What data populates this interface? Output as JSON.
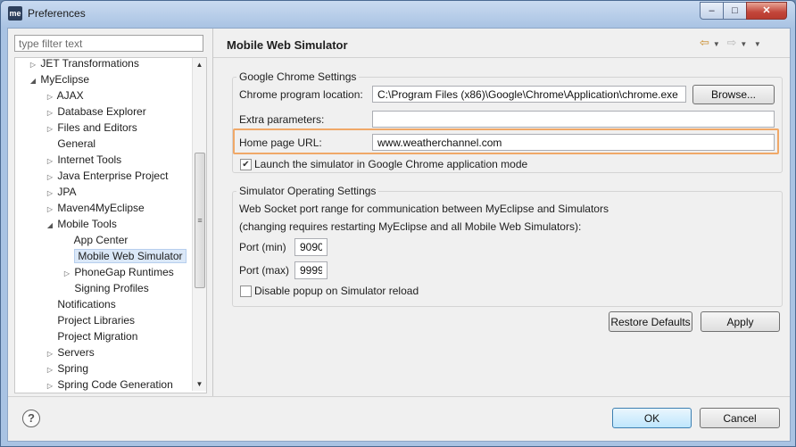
{
  "window": {
    "icon_text": "me",
    "title": "Preferences",
    "min": "–",
    "max": "□",
    "close": "✕"
  },
  "filter": {
    "placeholder": "type filter text"
  },
  "tree": {
    "items": [
      {
        "label": "JET Transformations",
        "arrow": "▷"
      },
      {
        "label": "MyEclipse",
        "arrow": "◢"
      },
      {
        "label": "AJAX",
        "arrow": "▷"
      },
      {
        "label": "Database Explorer",
        "arrow": "▷"
      },
      {
        "label": "Files and Editors",
        "arrow": "▷"
      },
      {
        "label": "General",
        "arrow": ""
      },
      {
        "label": "Internet Tools",
        "arrow": "▷"
      },
      {
        "label": "Java Enterprise Project",
        "arrow": "▷"
      },
      {
        "label": "JPA",
        "arrow": "▷"
      },
      {
        "label": "Maven4MyEclipse",
        "arrow": "▷"
      },
      {
        "label": "Mobile Tools",
        "arrow": "◢"
      },
      {
        "label": "App Center",
        "arrow": ""
      },
      {
        "label": "Mobile Web Simulator",
        "arrow": ""
      },
      {
        "label": "PhoneGap Runtimes",
        "arrow": "▷"
      },
      {
        "label": "Signing Profiles",
        "arrow": ""
      },
      {
        "label": "Notifications",
        "arrow": ""
      },
      {
        "label": "Project Libraries",
        "arrow": ""
      },
      {
        "label": "Project Migration",
        "arrow": ""
      },
      {
        "label": "Servers",
        "arrow": "▷"
      },
      {
        "label": "Spring",
        "arrow": "▷"
      },
      {
        "label": "Spring Code Generation",
        "arrow": "▷"
      }
    ],
    "selected": "Mobile Web Simulator"
  },
  "page": {
    "title": "Mobile Web Simulator"
  },
  "chrome": {
    "group_title": "Google Chrome Settings",
    "location_label": "Chrome program location:",
    "location_value": "C:\\Program Files (x86)\\Google\\Chrome\\Application\\chrome.exe",
    "browse_label": "Browse...",
    "extra_label": "Extra parameters:",
    "extra_value": "",
    "home_label": "Home page URL:",
    "home_value": "www.weatherchannel.com",
    "app_mode_label": "Launch the simulator in Google Chrome application mode",
    "app_mode_checked": true
  },
  "simulator": {
    "group_title": "Simulator Operating Settings",
    "desc1": "Web Socket port range for communication between MyEclipse and Simulators",
    "desc2": "(changing requires restarting MyEclipse and all Mobile Web Simulators):",
    "port_min_label": "Port (min)",
    "port_min_value": "9090",
    "port_max_label": "Port (max)",
    "port_max_value": "9999",
    "disable_popup_label": "Disable popup on Simulator reload",
    "disable_popup_checked": false
  },
  "buttons": {
    "restore": "Restore Defaults",
    "apply": "Apply",
    "ok": "OK",
    "cancel": "Cancel",
    "help": "?"
  }
}
